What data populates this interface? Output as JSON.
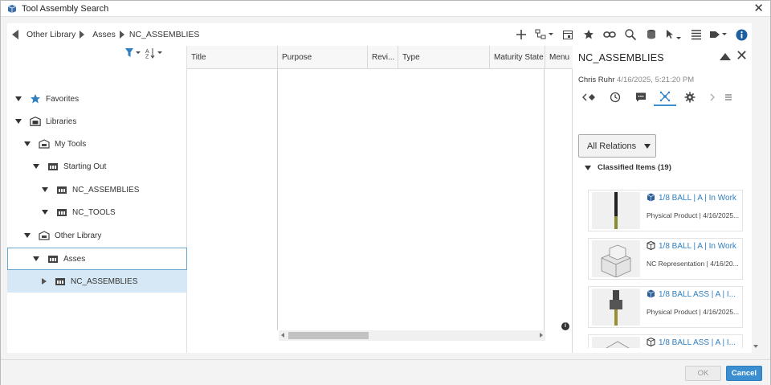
{
  "window": {
    "title": "Tool Assembly Search"
  },
  "breadcrumb": [
    "Other Library",
    "Asses",
    "NC_ASSEMBLIES"
  ],
  "tree": {
    "items": [
      {
        "label": "Favorites",
        "icon": "star-icon"
      },
      {
        "label": "Libraries",
        "icon": "libraries-icon"
      },
      {
        "label": "My Tools",
        "icon": "library-icon"
      },
      {
        "label": "Starting Out",
        "icon": "folder-icon"
      },
      {
        "label": "NC_ASSEMBLIES",
        "icon": "folder-icon"
      },
      {
        "label": "NC_TOOLS",
        "icon": "folder-icon"
      },
      {
        "label": "Other Library",
        "icon": "library-icon"
      },
      {
        "label": "Asses",
        "icon": "folder-icon"
      },
      {
        "label": "NC_ASSEMBLIES",
        "icon": "folder-icon"
      }
    ]
  },
  "table": {
    "columns": [
      "Title",
      "Purpose",
      "Revi...",
      "Type",
      "Maturity State",
      "Menu"
    ]
  },
  "side_panel": {
    "title": "NC_ASSEMBLIES",
    "owner": "Chris Ruhr",
    "date": "4/16/2025, 5:21:20 PM",
    "relations_button": "All Relations",
    "classified_header": "Classified Items (19)",
    "items": [
      {
        "name": "1/8 BALL | A | In Work",
        "subtitle": "Physical Product | 4/16/2025...",
        "icon": "physical-product-icon"
      },
      {
        "name": "1/8 BALL | A | In Work",
        "subtitle": "NC Representation | 4/16/20...",
        "icon": "representation-icon"
      },
      {
        "name": "1/8 BALL ASS | A | I...",
        "subtitle": "Physical Product | 4/16/2025...",
        "icon": "physical-product-icon"
      },
      {
        "name": "1/8 BALL ASS | A | I...",
        "subtitle": "",
        "icon": "representation-icon"
      }
    ]
  },
  "footer": {
    "ok_label": "OK",
    "cancel_label": "Cancel"
  },
  "colors": {
    "accent": "#3b8fd0",
    "selection": "#d6e8f5",
    "link": "#2f7fc1"
  }
}
